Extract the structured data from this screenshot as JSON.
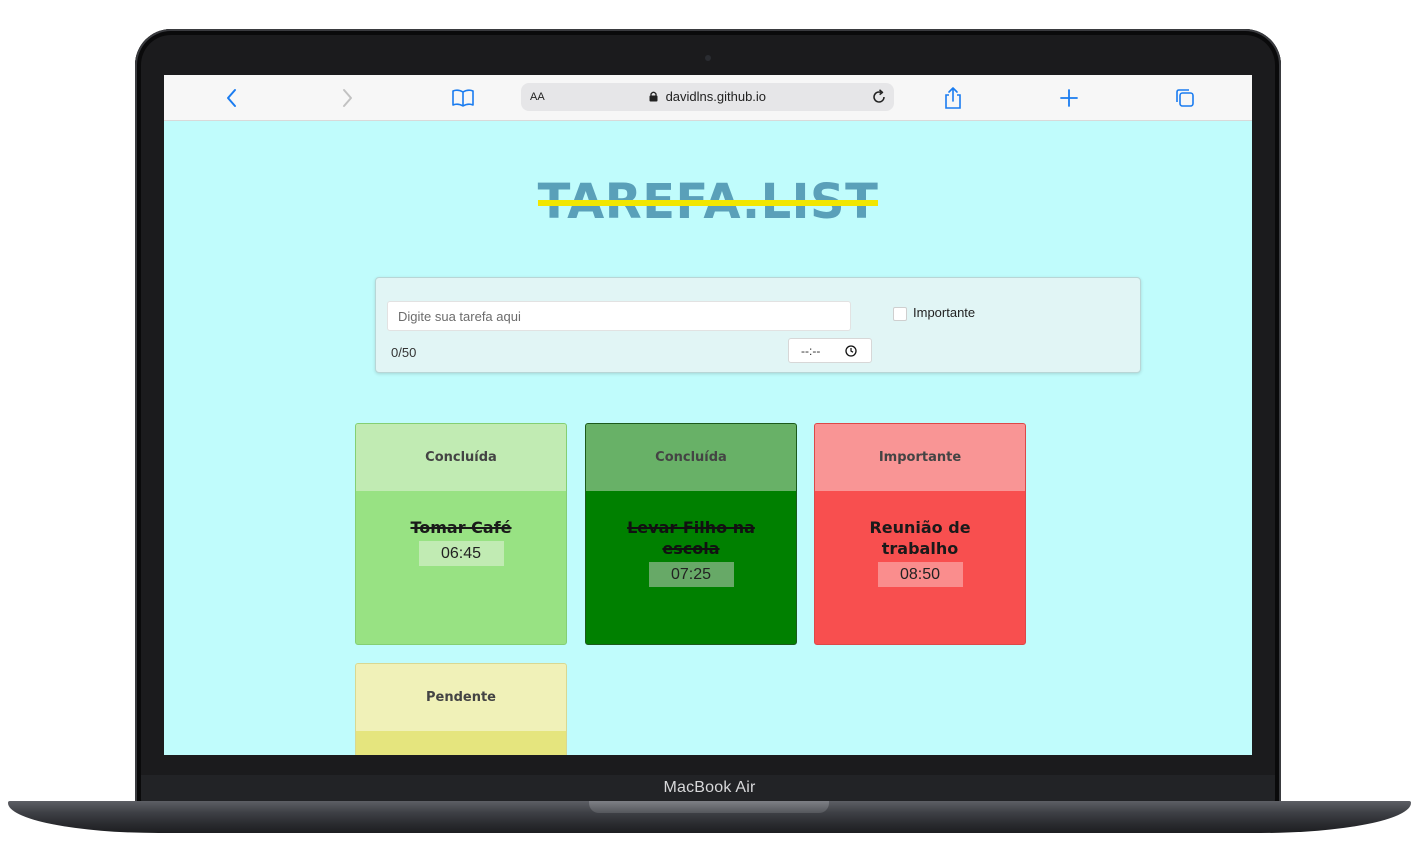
{
  "device": {
    "brand_label": "MacBook Air"
  },
  "browser": {
    "text_size_label": "AA",
    "url": "davidlns.github.io"
  },
  "page": {
    "title": "TAREFA.LIST",
    "form": {
      "placeholder": "Digite sua tarefa aqui",
      "counter": "0/50",
      "time_placeholder": "--:--",
      "important_label": "Importante",
      "important_checked": false
    },
    "tasks": [
      {
        "status": "Concluída",
        "title": "Tomar Café",
        "time": "06:45",
        "done": true,
        "head_color": "#c1ebb3",
        "body_color": "#98e283",
        "time_bg": "#c1ebb3",
        "title_color": "#1a1a1a",
        "border": "#84cf73"
      },
      {
        "status": "Concluída",
        "title": "Levar Filho na escola",
        "time": "07:25",
        "done": true,
        "head_color": "#68b167",
        "body_color": "#008000",
        "time_bg": "#67a967",
        "title_color": "#111111",
        "border": "#1c5a1c"
      },
      {
        "status": "Importante",
        "title": "Reunião de trabalho",
        "time": "08:50",
        "done": false,
        "head_color": "#f99595",
        "body_color": "#f84f4f",
        "time_bg": "#fa8d8d",
        "title_color": "#1a1a1a",
        "border": "#dd4848"
      },
      {
        "status": "Pendente",
        "title": "",
        "time": "",
        "done": false,
        "head_color": "#f0f1b8",
        "body_color": "#e5e57e",
        "time_bg": "#f0f1b8",
        "title_color": "#1a1a1a",
        "border": "#d8d892"
      }
    ]
  }
}
